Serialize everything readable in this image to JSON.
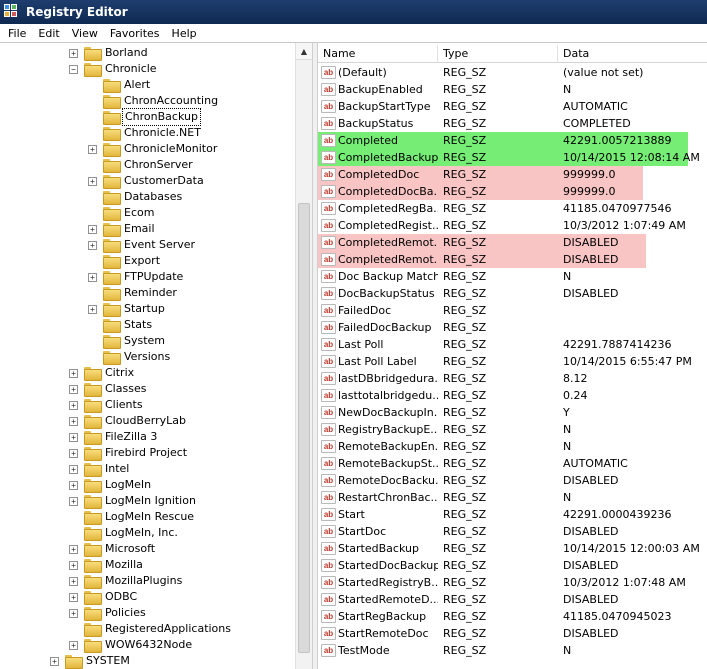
{
  "window": {
    "title": "Registry Editor"
  },
  "menu": [
    "File",
    "Edit",
    "View",
    "Favorites",
    "Help"
  ],
  "columns": {
    "name": "Name",
    "type": "Type",
    "data": "Data"
  },
  "tree": [
    {
      "label": "Borland",
      "depth": 1,
      "expander": "+"
    },
    {
      "label": "Chronicle",
      "depth": 1,
      "expander": "-"
    },
    {
      "label": "Alert",
      "depth": 2,
      "expander": ""
    },
    {
      "label": "ChronAccounting",
      "depth": 2,
      "expander": ""
    },
    {
      "label": "ChronBackup",
      "depth": 2,
      "expander": "",
      "selected": true
    },
    {
      "label": "Chronicle.NET",
      "depth": 2,
      "expander": ""
    },
    {
      "label": "ChronicleMonitor",
      "depth": 2,
      "expander": "+"
    },
    {
      "label": "ChronServer",
      "depth": 2,
      "expander": ""
    },
    {
      "label": "CustomerData",
      "depth": 2,
      "expander": "+"
    },
    {
      "label": "Databases",
      "depth": 2,
      "expander": ""
    },
    {
      "label": "Ecom",
      "depth": 2,
      "expander": ""
    },
    {
      "label": "Email",
      "depth": 2,
      "expander": "+"
    },
    {
      "label": "Event Server",
      "depth": 2,
      "expander": "+"
    },
    {
      "label": "Export",
      "depth": 2,
      "expander": ""
    },
    {
      "label": "FTPUpdate",
      "depth": 2,
      "expander": "+"
    },
    {
      "label": "Reminder",
      "depth": 2,
      "expander": ""
    },
    {
      "label": "Startup",
      "depth": 2,
      "expander": "+"
    },
    {
      "label": "Stats",
      "depth": 2,
      "expander": ""
    },
    {
      "label": "System",
      "depth": 2,
      "expander": ""
    },
    {
      "label": "Versions",
      "depth": 2,
      "expander": ""
    },
    {
      "label": "Citrix",
      "depth": 1,
      "expander": "+"
    },
    {
      "label": "Classes",
      "depth": 1,
      "expander": "+"
    },
    {
      "label": "Clients",
      "depth": 1,
      "expander": "+"
    },
    {
      "label": "CloudBerryLab",
      "depth": 1,
      "expander": "+"
    },
    {
      "label": "FileZilla 3",
      "depth": 1,
      "expander": "+"
    },
    {
      "label": "Firebird Project",
      "depth": 1,
      "expander": "+"
    },
    {
      "label": "Intel",
      "depth": 1,
      "expander": "+"
    },
    {
      "label": "LogMeIn",
      "depth": 1,
      "expander": "+"
    },
    {
      "label": "LogMeIn Ignition",
      "depth": 1,
      "expander": "+"
    },
    {
      "label": "LogMeIn Rescue",
      "depth": 1,
      "expander": ""
    },
    {
      "label": "LogMeIn, Inc.",
      "depth": 1,
      "expander": ""
    },
    {
      "label": "Microsoft",
      "depth": 1,
      "expander": "+"
    },
    {
      "label": "Mozilla",
      "depth": 1,
      "expander": "+"
    },
    {
      "label": "MozillaPlugins",
      "depth": 1,
      "expander": "+"
    },
    {
      "label": "ODBC",
      "depth": 1,
      "expander": "+"
    },
    {
      "label": "Policies",
      "depth": 1,
      "expander": "+"
    },
    {
      "label": "RegisteredApplications",
      "depth": 1,
      "expander": ""
    },
    {
      "label": "WOW6432Node",
      "depth": 1,
      "expander": "+"
    },
    {
      "label": "SYSTEM",
      "depth": 0,
      "expander": "+"
    }
  ],
  "values": [
    {
      "name": "(Default)",
      "type": "REG_SZ",
      "data": "(value not set)",
      "hl": ""
    },
    {
      "name": "BackupEnabled",
      "type": "REG_SZ",
      "data": "N",
      "hl": ""
    },
    {
      "name": "BackupStartType",
      "type": "REG_SZ",
      "data": "AUTOMATIC",
      "hl": ""
    },
    {
      "name": "BackupStatus",
      "type": "REG_SZ",
      "data": "COMPLETED",
      "hl": ""
    },
    {
      "name": "Completed",
      "type": "REG_SZ",
      "data": "42291.0057213889",
      "hl": "green"
    },
    {
      "name": "CompletedBackup",
      "type": "REG_SZ",
      "data": "10/14/2015 12:08:14 AM",
      "hl": "green"
    },
    {
      "name": "CompletedDoc",
      "type": "REG_SZ",
      "data": "999999.0",
      "hl": "red"
    },
    {
      "name": "CompletedDocBa...",
      "type": "REG_SZ",
      "data": "999999.0",
      "hl": "red"
    },
    {
      "name": "CompletedRegBa...",
      "type": "REG_SZ",
      "data": "41185.0470977546",
      "hl": ""
    },
    {
      "name": "CompletedRegist...",
      "type": "REG_SZ",
      "data": "10/3/2012 1:07:49 AM",
      "hl": ""
    },
    {
      "name": "CompletedRemot...",
      "type": "REG_SZ",
      "data": "DISABLED",
      "hl": "red"
    },
    {
      "name": "CompletedRemot...",
      "type": "REG_SZ",
      "data": "DISABLED",
      "hl": "red"
    },
    {
      "name": "Doc Backup Match",
      "type": "REG_SZ",
      "data": "N",
      "hl": ""
    },
    {
      "name": "DocBackupStatus",
      "type": "REG_SZ",
      "data": "DISABLED",
      "hl": ""
    },
    {
      "name": "FailedDoc",
      "type": "REG_SZ",
      "data": "",
      "hl": ""
    },
    {
      "name": "FailedDocBackup",
      "type": "REG_SZ",
      "data": "",
      "hl": ""
    },
    {
      "name": "Last Poll",
      "type": "REG_SZ",
      "data": "42291.7887414236",
      "hl": ""
    },
    {
      "name": "Last Poll Label",
      "type": "REG_SZ",
      "data": "10/14/2015 6:55:47 PM",
      "hl": ""
    },
    {
      "name": "lastDBbridgedura...",
      "type": "REG_SZ",
      "data": "8.12",
      "hl": ""
    },
    {
      "name": "lasttotalbridgedu...",
      "type": "REG_SZ",
      "data": "0.24",
      "hl": ""
    },
    {
      "name": "NewDocBackupIn...",
      "type": "REG_SZ",
      "data": "Y",
      "hl": ""
    },
    {
      "name": "RegistryBackupE...",
      "type": "REG_SZ",
      "data": "N",
      "hl": ""
    },
    {
      "name": "RemoteBackupEn...",
      "type": "REG_SZ",
      "data": "N",
      "hl": ""
    },
    {
      "name": "RemoteBackupSt...",
      "type": "REG_SZ",
      "data": "AUTOMATIC",
      "hl": ""
    },
    {
      "name": "RemoteDocBacku...",
      "type": "REG_SZ",
      "data": "DISABLED",
      "hl": ""
    },
    {
      "name": "RestartChronBac...",
      "type": "REG_SZ",
      "data": "N",
      "hl": ""
    },
    {
      "name": "Start",
      "type": "REG_SZ",
      "data": "42291.0000439236",
      "hl": ""
    },
    {
      "name": "StartDoc",
      "type": "REG_SZ",
      "data": "DISABLED",
      "hl": ""
    },
    {
      "name": "StartedBackup",
      "type": "REG_SZ",
      "data": "10/14/2015 12:00:03 AM",
      "hl": ""
    },
    {
      "name": "StartedDocBackup",
      "type": "REG_SZ",
      "data": "DISABLED",
      "hl": ""
    },
    {
      "name": "StartedRegistryB...",
      "type": "REG_SZ",
      "data": "10/3/2012 1:07:48 AM",
      "hl": ""
    },
    {
      "name": "StartedRemoteD...",
      "type": "REG_SZ",
      "data": "DISABLED",
      "hl": ""
    },
    {
      "name": "StartRegBackup",
      "type": "REG_SZ",
      "data": "41185.0470945023",
      "hl": ""
    },
    {
      "name": "StartRemoteDoc",
      "type": "REG_SZ",
      "data": "DISABLED",
      "hl": ""
    },
    {
      "name": "TestMode",
      "type": "REG_SZ",
      "data": "N",
      "hl": ""
    }
  ],
  "icons": {
    "value": "string-value-icon",
    "folder": "folder-icon",
    "app": "registry-editor-icon"
  },
  "colors": {
    "green_highlight": "#76ee76",
    "red_highlight": "#f8c4c4",
    "titlebar": "#1e3d6e"
  }
}
